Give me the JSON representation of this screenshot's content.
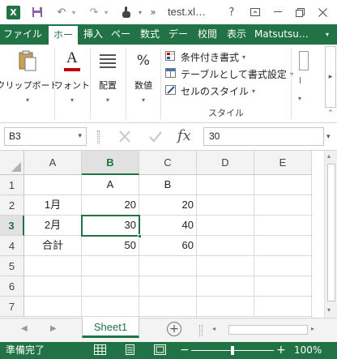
{
  "title_bar": {
    "filename": "test.xl…",
    "help_label": "?",
    "more_label": "»"
  },
  "tabs": [
    {
      "label": "ファイル"
    },
    {
      "label": "ホー"
    },
    {
      "label": "挿入"
    },
    {
      "label": "ペー"
    },
    {
      "label": "数式"
    },
    {
      "label": "デー"
    },
    {
      "label": "校閲"
    },
    {
      "label": "表示"
    },
    {
      "label": "Matsutsu…"
    }
  ],
  "ribbon": {
    "clipboard_label": "クリップボード",
    "font_label": "フォント",
    "align_label": "配置",
    "number_label": "数値",
    "percent_glyph": "%",
    "cond_format_label": "条件付き書式",
    "table_format_label": "テーブルとして書式設定",
    "cell_style_label": "セルのスタイル",
    "style_group_label": "スタイル",
    "font_glyph": "A"
  },
  "formula_bar": {
    "name_box": "B3",
    "fx_label": "fx",
    "formula_value": "30"
  },
  "grid": {
    "columns": [
      "A",
      "B",
      "C",
      "D",
      "E"
    ],
    "rows": [
      "1",
      "2",
      "3",
      "4",
      "5",
      "6",
      "7"
    ],
    "cells": {
      "B1": "A",
      "C1": "B",
      "A2": "1月",
      "B2": "20",
      "C2": "20",
      "A3": "2月",
      "B3": "30",
      "C3": "40",
      "A4": "合計",
      "B4": "50",
      "C4": "60"
    },
    "active_cell": "B3"
  },
  "sheet_tabs": {
    "active": "Sheet1",
    "add_label": "+"
  },
  "status_bar": {
    "status_text": "準備完了",
    "zoom": "100%",
    "zoom_minus": "−",
    "zoom_plus": "+"
  },
  "colors": {
    "accent": "#217346",
    "header_bg": "#f3f3f3",
    "selected_header_bg": "#e1e1e1"
  }
}
